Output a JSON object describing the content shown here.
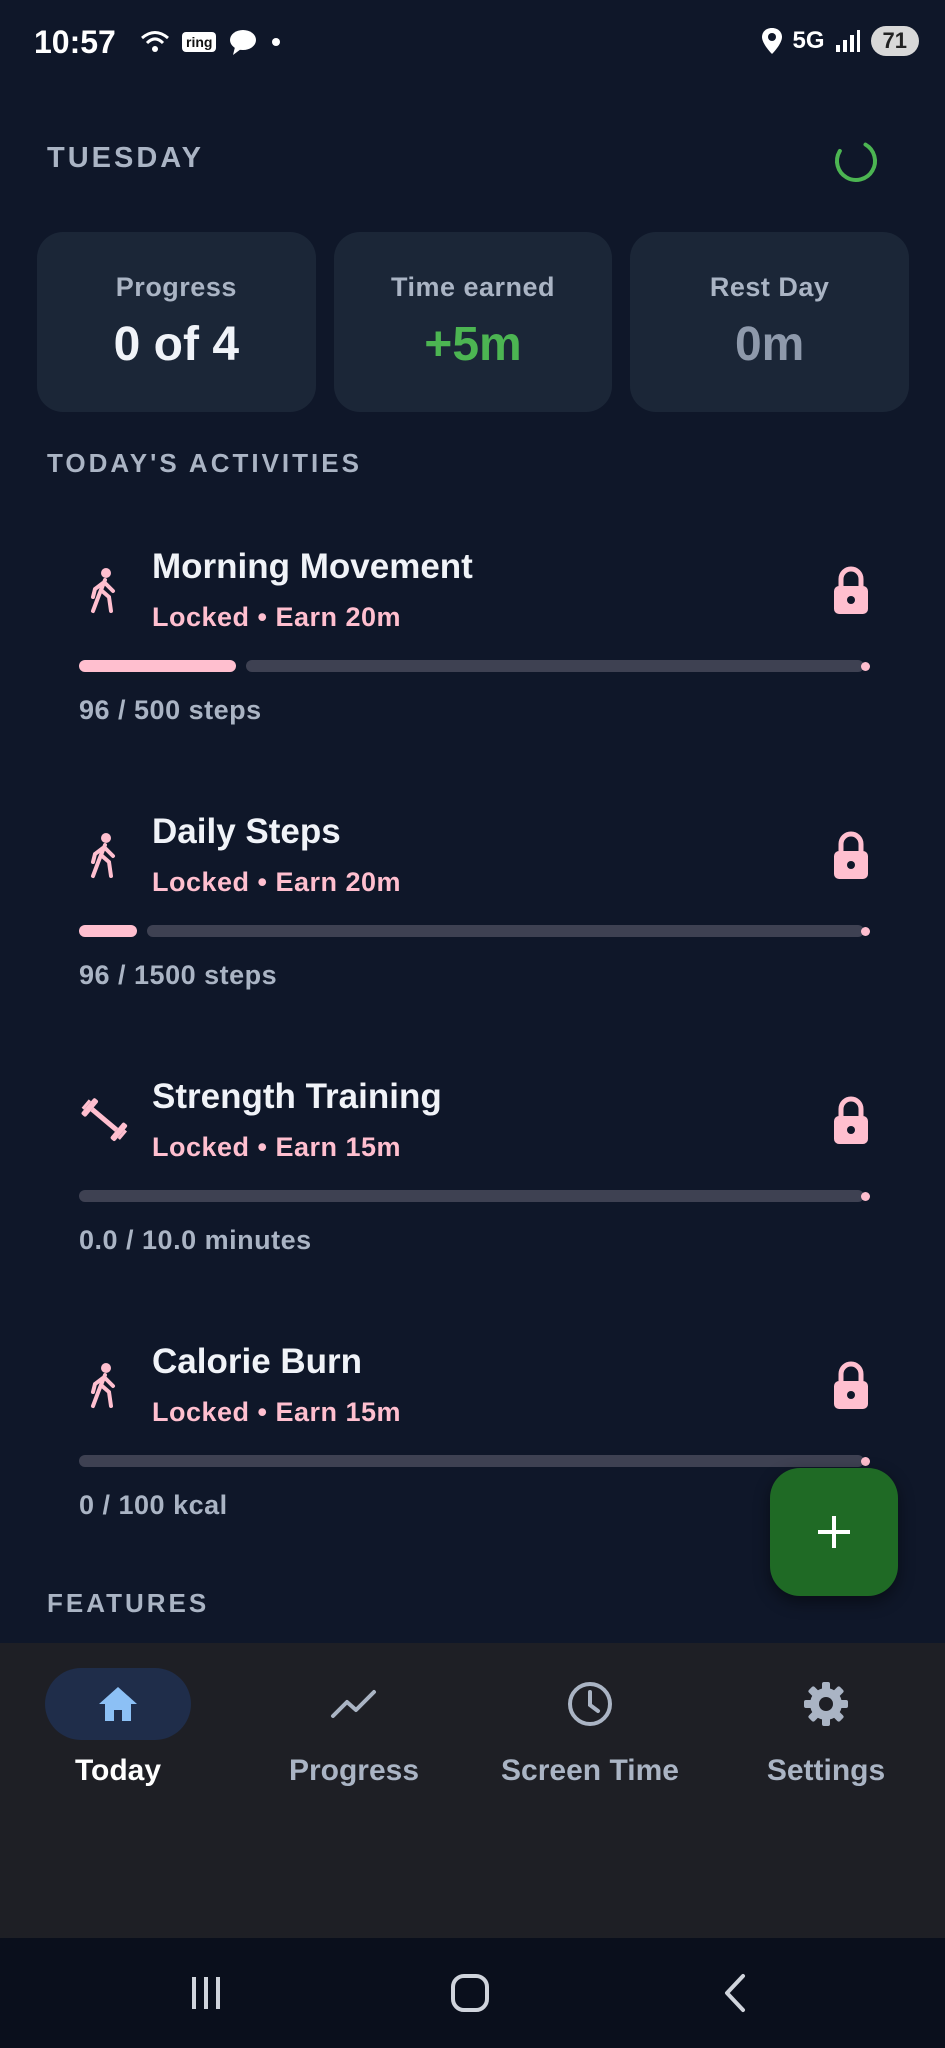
{
  "status_bar": {
    "time": "10:57",
    "network": "5G",
    "battery": "71",
    "ring_label": "ring"
  },
  "header": {
    "day": "TUESDAY"
  },
  "summary": {
    "progress_label": "Progress",
    "progress_value": "0 of 4",
    "earned_label": "Time earned",
    "earned_value": "+5m",
    "rest_label": "Rest Day",
    "rest_value": "0m",
    "colors": {
      "earned": "#4cb552",
      "rest": "#8e99ab"
    }
  },
  "activities_title": "TODAY'S ACTIVITIES",
  "activities": [
    {
      "title": "Morning Movement",
      "status": "Locked • Earn 20m",
      "progress_text": "96 / 500 steps",
      "progress": 0.192,
      "icon": "walking-icon"
    },
    {
      "title": "Daily Steps",
      "status": "Locked • Earn 20m",
      "progress_text": "96 / 1500 steps",
      "progress": 0.064,
      "icon": "walking-icon"
    },
    {
      "title": "Strength Training",
      "status": "Locked • Earn 15m",
      "progress_text": "0.0 / 10.0 minutes",
      "progress": 0,
      "icon": "dumbbell-icon"
    },
    {
      "title": "Calorie Burn",
      "status": "Locked • Earn 15m",
      "progress_text": "0 / 100 kcal",
      "progress": 0,
      "icon": "walking-icon"
    }
  ],
  "features_title": "FEATURES",
  "fab": {
    "icon": "plus-icon"
  },
  "bottom_nav": [
    {
      "label": "Today",
      "icon": "home-icon",
      "active": true
    },
    {
      "label": "Progress",
      "icon": "trend-icon",
      "active": false
    },
    {
      "label": "Screen Time",
      "icon": "clock-icon",
      "active": false
    },
    {
      "label": "Settings",
      "icon": "gear-icon",
      "active": false
    }
  ],
  "colors": {
    "background": "#0f1729",
    "card": "#1b2637",
    "accent_pink": "#ffbfcf",
    "nav_active": "#1f2d4a",
    "fab": "#1f6a25"
  }
}
